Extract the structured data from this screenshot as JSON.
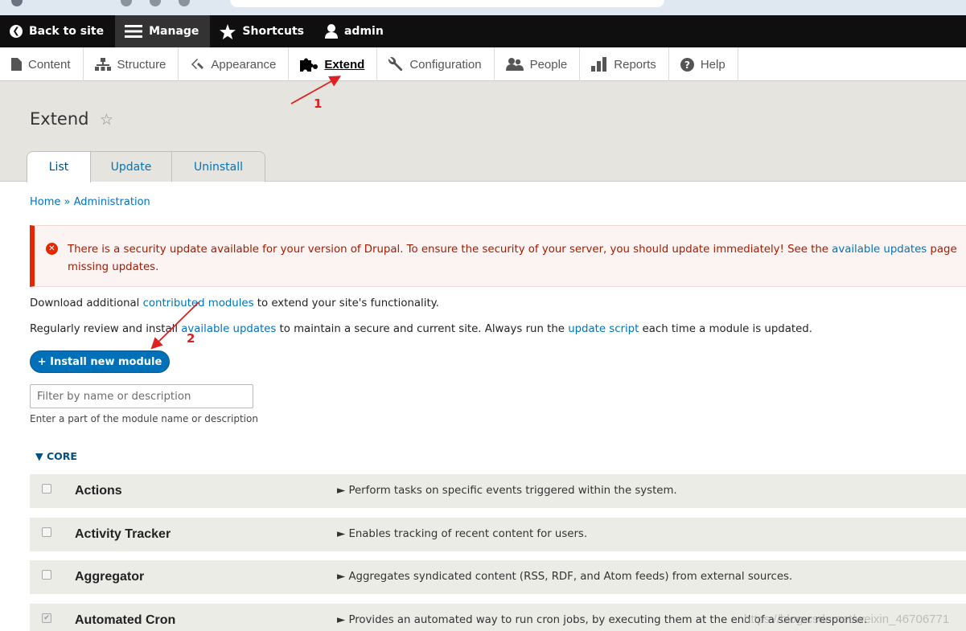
{
  "toolbar": {
    "back": "Back to site",
    "manage": "Manage",
    "shortcuts": "Shortcuts",
    "user": "admin"
  },
  "menu": {
    "content": "Content",
    "structure": "Structure",
    "appearance": "Appearance",
    "extend": "Extend",
    "configuration": "Configuration",
    "people": "People",
    "reports": "Reports",
    "help": "Help"
  },
  "page": {
    "title": "Extend",
    "tabs": [
      "List",
      "Update",
      "Uninstall"
    ]
  },
  "breadcrumb": {
    "home": "Home",
    "sep": "»",
    "admin": "Administration"
  },
  "alert": {
    "text1": "There is a security update available for your version of Drupal. To ensure the security of your server, you should update immediately! See the ",
    "link": "available updates",
    "text2": " page",
    "line2": "missing updates."
  },
  "intro": {
    "p1_a": "Download additional ",
    "p1_link": "contributed modules",
    "p1_b": " to extend your site's functionality.",
    "p2_a": "Regularly review and install ",
    "p2_link1": "available updates",
    "p2_b": " to maintain a secure and current site. Always run the ",
    "p2_link2": "update script",
    "p2_c": " each time a module is updated."
  },
  "install_button": "+ Install new module",
  "filter": {
    "placeholder": "Filter by name or description",
    "help": "Enter a part of the module name or description"
  },
  "core_label": "▼ CORE",
  "modules": [
    {
      "name": "Actions",
      "desc": "► Perform tasks on specific events triggered within the system.",
      "checked": false
    },
    {
      "name": "Activity Tracker",
      "desc": "► Enables tracking of recent content for users.",
      "checked": false
    },
    {
      "name": "Aggregator",
      "desc": "► Aggregates syndicated content (RSS, RDF, and Atom feeds) from external sources.",
      "checked": false
    },
    {
      "name": "Automated Cron",
      "desc": "► Provides an automated way to run cron jobs, by executing them at the end of a server response.",
      "checked": true
    }
  ],
  "annotations": {
    "one": "1",
    "two": "2"
  },
  "watermark": "https://blog.csdn.net/weixin_46706771",
  "colors": {
    "toolbar": "#0f0f0f",
    "link": "#0074bd",
    "button": "#0071b8",
    "alert_border": "#e62600",
    "annotation": "#e02020"
  }
}
